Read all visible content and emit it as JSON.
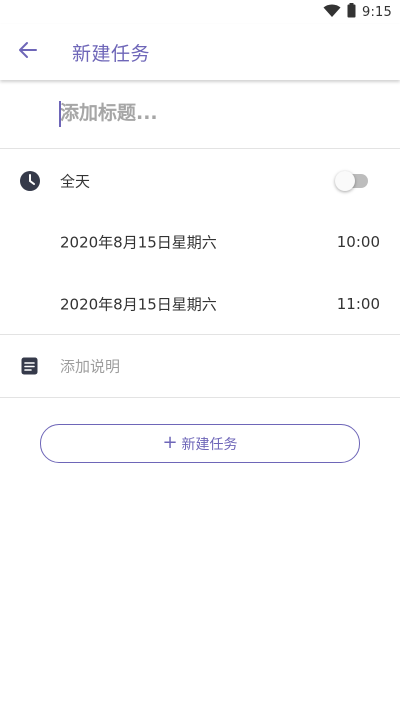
{
  "status_bar": {
    "time": "9:15",
    "icons": [
      "wifi-icon",
      "battery-icon"
    ]
  },
  "app_bar": {
    "back_icon": "arrow-left-icon",
    "title": "新建任务"
  },
  "title_field": {
    "placeholder": "添加标题...",
    "value": ""
  },
  "all_day": {
    "icon": "clock-icon",
    "label": "全天",
    "enabled": false
  },
  "start": {
    "date": "2020年8月15日星期六",
    "time": "10:00"
  },
  "end": {
    "date": "2020年8月15日星期六",
    "time": "11:00"
  },
  "description": {
    "icon": "notes-icon",
    "label": "添加说明"
  },
  "create_button": {
    "icon": "plus",
    "label": "新建任务"
  },
  "colors": {
    "accent": "#6e66b8",
    "icon_dark": "#353a4a",
    "divider": "#e3e3e3",
    "placeholder": "#a6a6a6"
  }
}
